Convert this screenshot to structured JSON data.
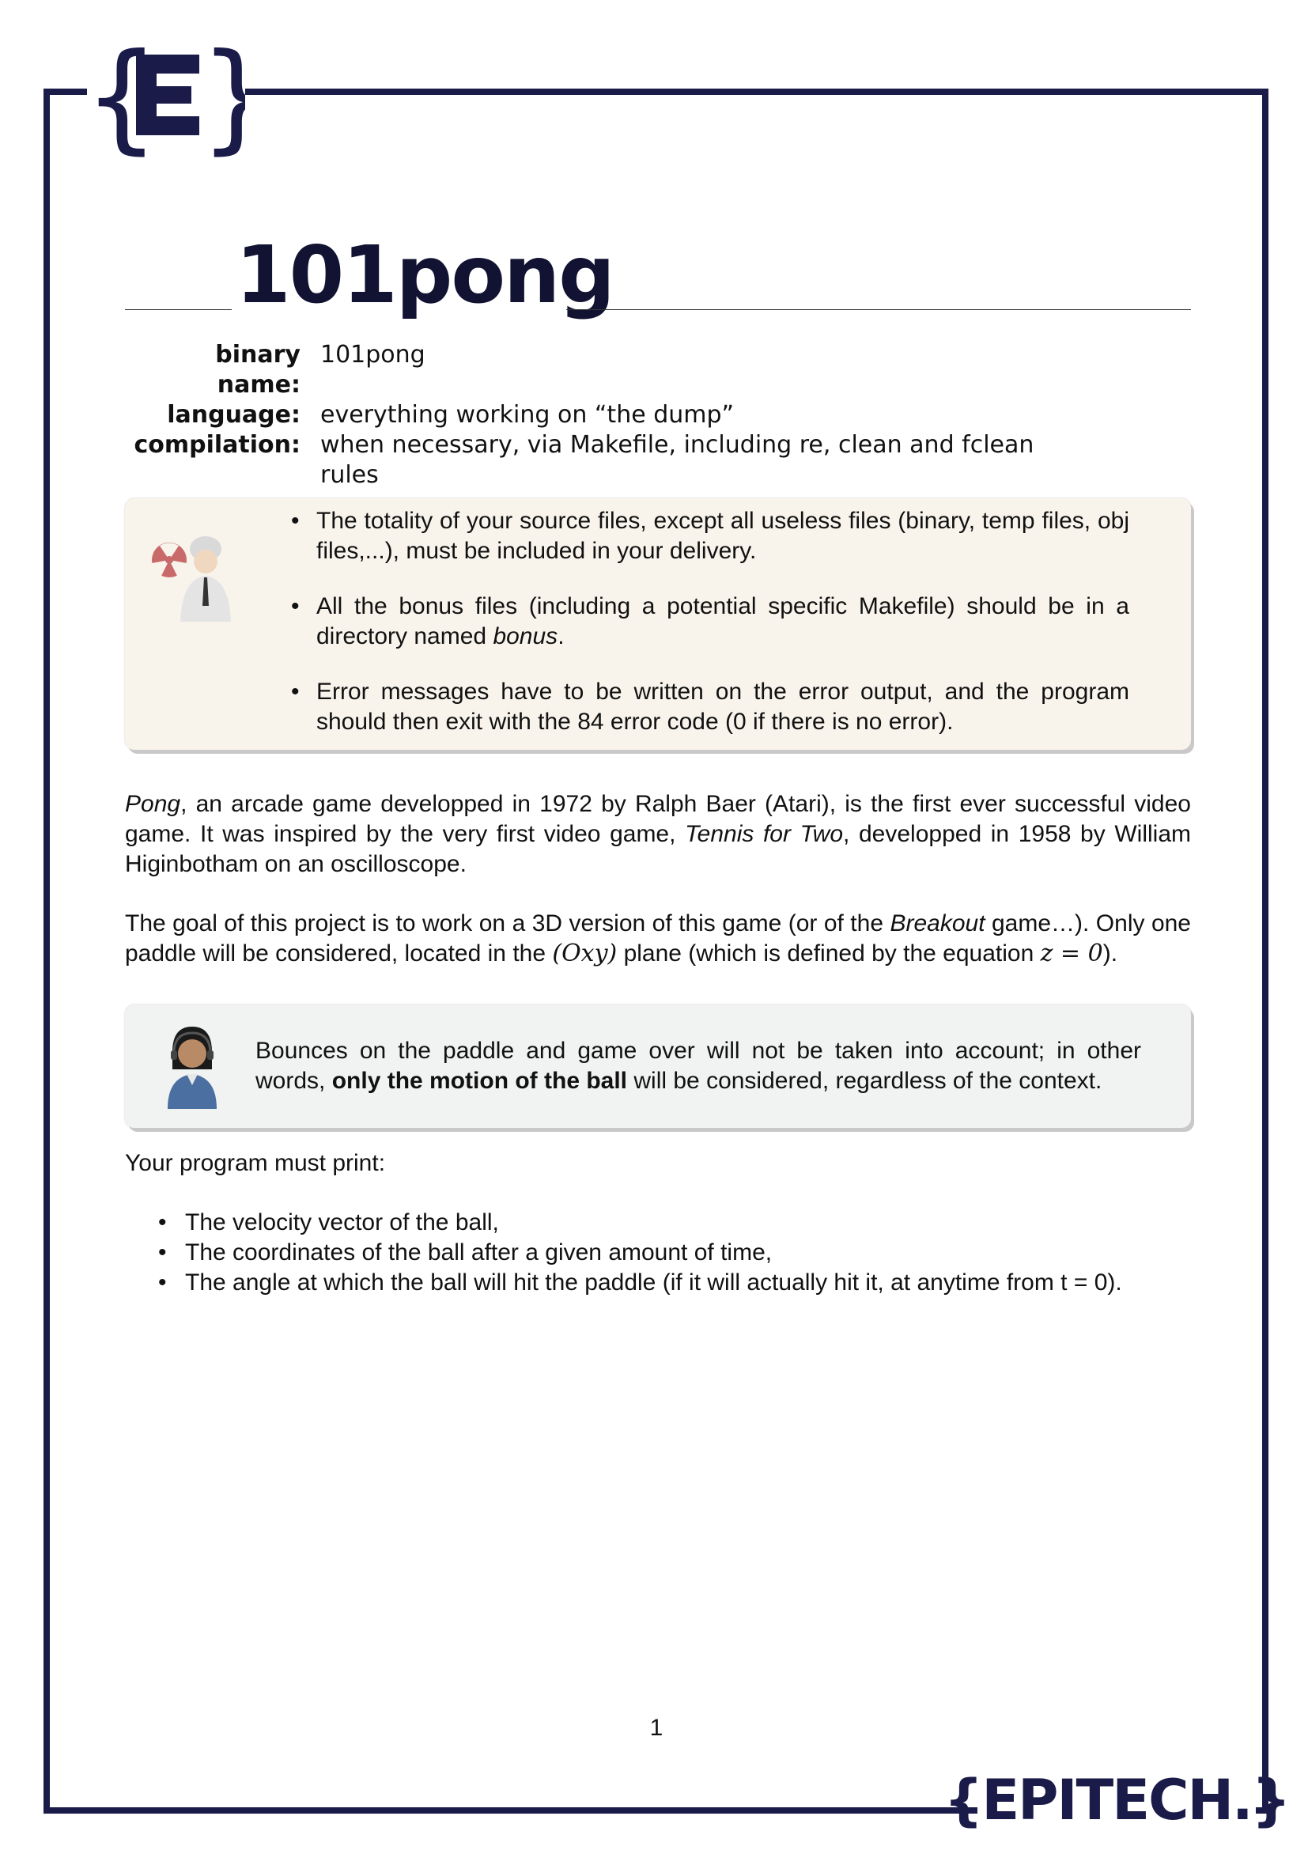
{
  "header": {
    "logo_letter": "{E}"
  },
  "title": "101pong",
  "meta": [
    {
      "key": "binary name:",
      "value": "101pong"
    },
    {
      "key": "language:",
      "value": "everything working on “the dump”"
    },
    {
      "key": "compilation:",
      "value": "when necessary, via Makefile, including re, clean and fclean rules"
    }
  ],
  "warning_box": {
    "items": [
      {
        "text": "The totality of your source files, except all useless files (binary, temp files, obj files,...), must be included in your delivery."
      },
      {
        "pre": "All the bonus files (including a potential specific Makefile) should be in a directory named ",
        "em": "bonus",
        "post": "."
      },
      {
        "text": "Error messages have to be written on the error output, and the program should then exit with the 84 error code (0 if there is no error)."
      }
    ]
  },
  "para1": {
    "em1": "Pong",
    "t1": ", an arcade game developped in 1972 by Ralph Baer (Atari), is the first ever successful video game. It was inspired by the very first video game, ",
    "em2": "Tennis for Two",
    "t2": ", developped in 1958 by William Higinbotham on an oscilloscope."
  },
  "para2": {
    "t1": "The goal of this project is to work on a 3D version of this game (or of the ",
    "em": "Breakout",
    "t2": " game…). Only one paddle will be considered, located in the ",
    "math1": "(Oxy)",
    "t3": " plane (which is defined by the equation ",
    "math2": "z = 0",
    "t4": ")."
  },
  "note_box": {
    "t1": "Bounces on the paddle and game over will not be taken into account; in other words, ",
    "bold": "only the motion of the ball",
    "t2": " will be considered, regardless of the context."
  },
  "para3": "Your program must print:",
  "print_list": [
    "The velocity vector of the ball,",
    "The coordinates of the ball after a given amount of time,",
    "The angle at which the ball will hit the paddle (if it will actually hit it, at anytime from t = 0)."
  ],
  "page_number": "1",
  "footer": {
    "logo_text": "{EPITECH.}"
  },
  "colors": {
    "brand": "#1b1b4a",
    "warning_bg": "#f8f4ec",
    "note_bg": "#f1f2f2"
  }
}
